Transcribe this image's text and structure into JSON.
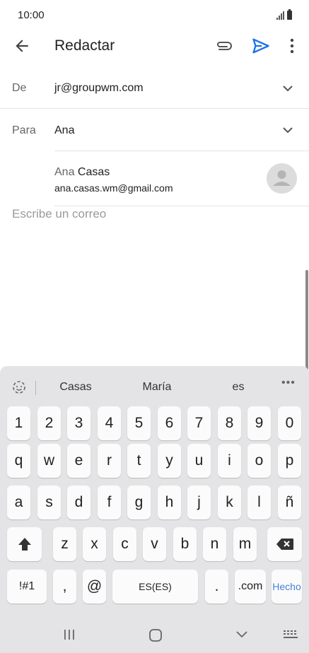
{
  "status": {
    "time": "10:00"
  },
  "appbar": {
    "title": "Redactar"
  },
  "from": {
    "label": "De",
    "value": "jr@groupwm.com"
  },
  "to": {
    "label": "Para",
    "value": "Ana"
  },
  "suggestion": {
    "name_first": "Ana",
    "name_last": "Casas",
    "email": "ana.casas.wm@gmail.com"
  },
  "compose": {
    "placeholder": "Escribe un correo"
  },
  "keyboard": {
    "suggestions": [
      "Casas",
      "María",
      "es"
    ],
    "more": "•••",
    "numbers": [
      "1",
      "2",
      "3",
      "4",
      "5",
      "6",
      "7",
      "8",
      "9",
      "0"
    ],
    "row1": [
      "q",
      "w",
      "e",
      "r",
      "t",
      "y",
      "u",
      "i",
      "o",
      "p"
    ],
    "row2": [
      "a",
      "s",
      "d",
      "f",
      "g",
      "h",
      "j",
      "k",
      "l",
      "ñ"
    ],
    "row3": [
      "z",
      "x",
      "c",
      "v",
      "b",
      "n",
      "m"
    ],
    "symbols": "!#1",
    "comma": ",",
    "at": "@",
    "space": "ES(ES)",
    "period": ".",
    "dotcom": ".com",
    "done": "Hecho"
  },
  "icons": {
    "back": "arrow-back-icon",
    "attach": "paperclip-icon",
    "send": "send-icon",
    "more": "more-vert-icon",
    "accent": "#1a73e8"
  }
}
